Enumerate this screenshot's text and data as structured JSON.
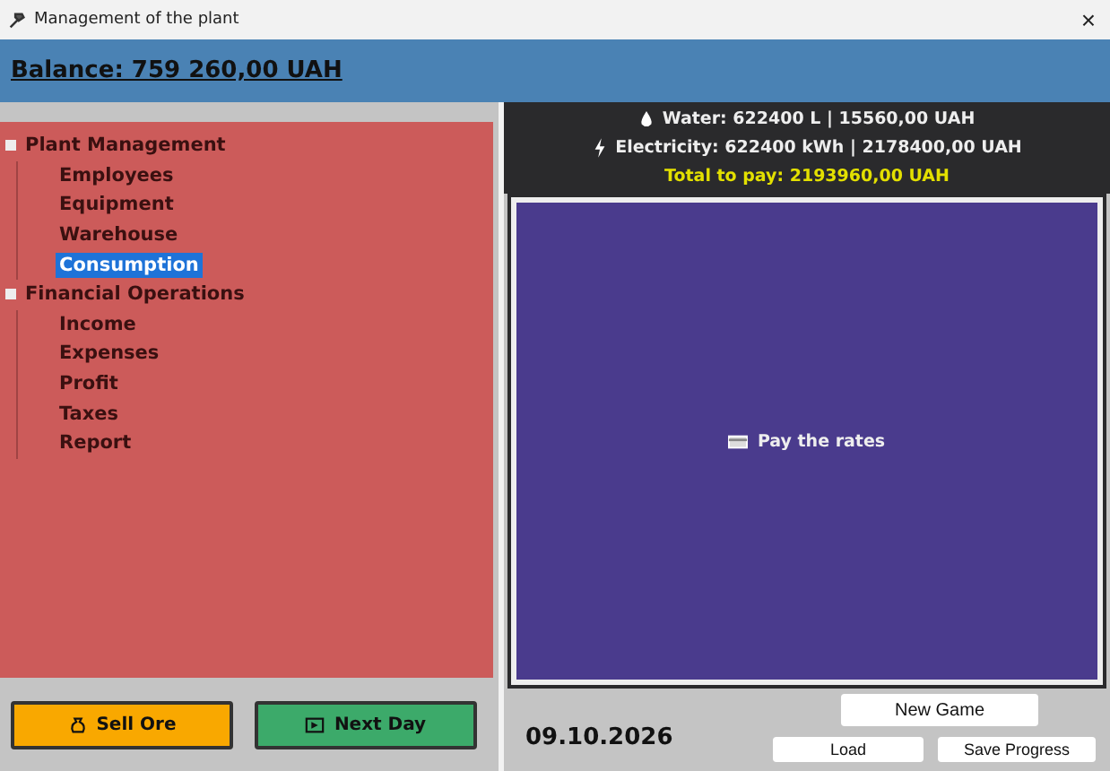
{
  "window": {
    "title": "Management of the plant",
    "close": "×"
  },
  "balance": "Balance: 759 260,00 UAH",
  "tree": [
    {
      "label": "Plant Management",
      "expanded": true,
      "selected": false,
      "children": [
        {
          "label": "Employees",
          "selected": false
        },
        {
          "label": "Equipment",
          "selected": false
        },
        {
          "label": "Warehouse",
          "selected": false
        },
        {
          "label": "Consumption",
          "selected": true
        }
      ]
    },
    {
      "label": "Financial Operations",
      "expanded": true,
      "selected": false,
      "children": [
        {
          "label": "Income",
          "selected": false
        },
        {
          "label": "Expenses",
          "selected": false
        },
        {
          "label": "Profit",
          "selected": false
        },
        {
          "label": "Taxes",
          "selected": false
        },
        {
          "label": "Report",
          "selected": false
        }
      ]
    }
  ],
  "consumption": [
    {
      "kind": "water",
      "text": "Water: 622400 L | 15560,00 UAH"
    },
    {
      "kind": "electricity",
      "text": "Electricity: 622400 kWh | 2178400,00 UAH"
    },
    {
      "kind": "total",
      "text": "Total to pay: 2193960,00 UAH"
    }
  ],
  "pay_button": "Pay the rates",
  "sell_button": "Sell Ore",
  "next_day_button": "Next Day",
  "date": "09.10.2026",
  "new_game_button": "New Game",
  "load_button": "Load",
  "save_button": "Save Progress"
}
